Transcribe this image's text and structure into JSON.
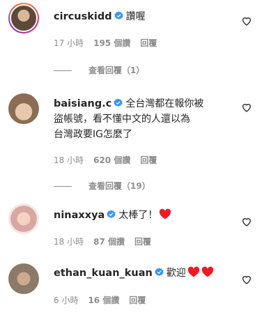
{
  "comments": [
    {
      "username": "circuskidd",
      "text": "讚喔",
      "time": "17 小時",
      "likes": "195 個讚",
      "reply": "回覆",
      "view_replies": "查看回覆（1）"
    },
    {
      "username": "baisiang.c",
      "text_line1": "全台灣都在報你被",
      "text_line2": "盜帳號，看不懂中文的人還以為",
      "text_line3": "台灣政要IG怎麼了",
      "time": "18 小時",
      "likes": "620 個讚",
      "reply": "回覆",
      "view_replies": "查看回覆（19）"
    },
    {
      "username": "ninaxxya",
      "text": "太棒了！",
      "time": "18 小時",
      "likes": "87 個讚",
      "reply": "回覆"
    },
    {
      "username": "ethan_kuan_kuan",
      "text": "歡迎",
      "time": "6 小時",
      "likes": "16 個讚",
      "reply": "回覆"
    }
  ],
  "colors": {
    "verified": "#3897f0",
    "heart_red": "#ed4956",
    "secondary_text": "#8e8e8e"
  },
  "icons": [
    "verified-badge-icon",
    "heart-outline-icon",
    "red-heart-emoji"
  ]
}
